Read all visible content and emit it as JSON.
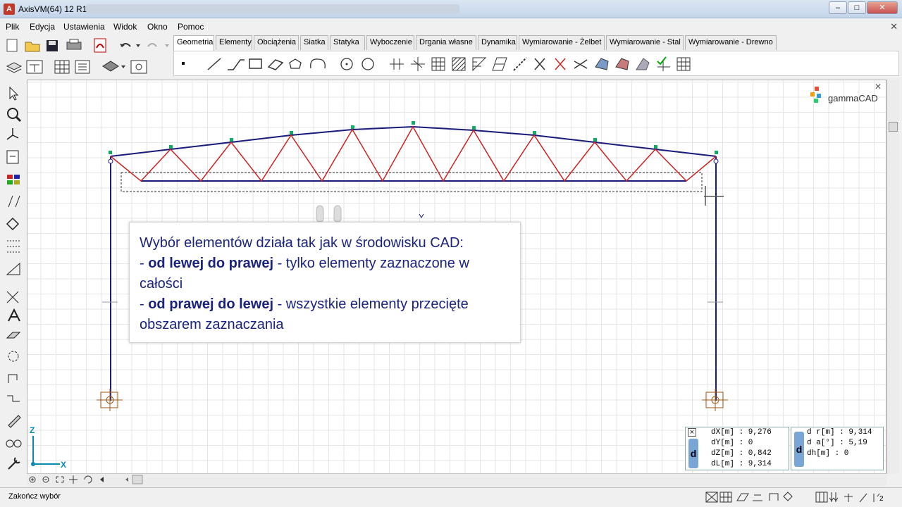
{
  "window": {
    "title": "AxisVM(64) 12 R1",
    "minimize": "–",
    "maximize": "□",
    "close": "✕"
  },
  "menu": {
    "items": [
      "Plik",
      "Edycja",
      "Ustawienia",
      "Widok",
      "Okno",
      "Pomoc"
    ],
    "close_glyph": "✕"
  },
  "tabs": [
    "Geometria",
    "Elementy",
    "Obciążenia",
    "Siatka",
    "Statyka",
    "Wyboczenie",
    "Drgania własne",
    "Dynamika",
    "Wymiarowanie - Żelbet",
    "Wymiarowanie - Stal",
    "Wymiarowanie - Drewno"
  ],
  "active_tab": "Geometria",
  "canvas": {
    "logo": "gammaCAD",
    "axis_z": "Z",
    "axis_x": "X",
    "close_glyph": "✕"
  },
  "popup": {
    "line1": "Wybór elementów działa tak jak w środowisku CAD:",
    "line2_prefix": "- ",
    "line2_bold": "od lewej do prawej",
    "line2_rest": " - tylko elementy zaznaczone w całości",
    "line3_prefix": "- ",
    "line3_bold": "od prawej do lewej",
    "line3_rest": " - wszystkie elementy przecięte obszarem zaznaczania"
  },
  "coords_left": {
    "d": "d",
    "rows": [
      "dX[m] : 9,276",
      "dY[m] : 0",
      "dZ[m] : 0,842",
      "dL[m] : 9,314"
    ]
  },
  "coords_right": {
    "d": "d",
    "rows": [
      "d r[m] : 9,314",
      "d a[°] : 5,19",
      "dh[m] : 0"
    ]
  },
  "status": {
    "text": "Zakończ wybór"
  },
  "colors": {
    "truss_chord": "#1a1a7a",
    "truss_web": "#cc2222",
    "popup_text": "#1a237e",
    "axis": "#0a8ab0"
  }
}
